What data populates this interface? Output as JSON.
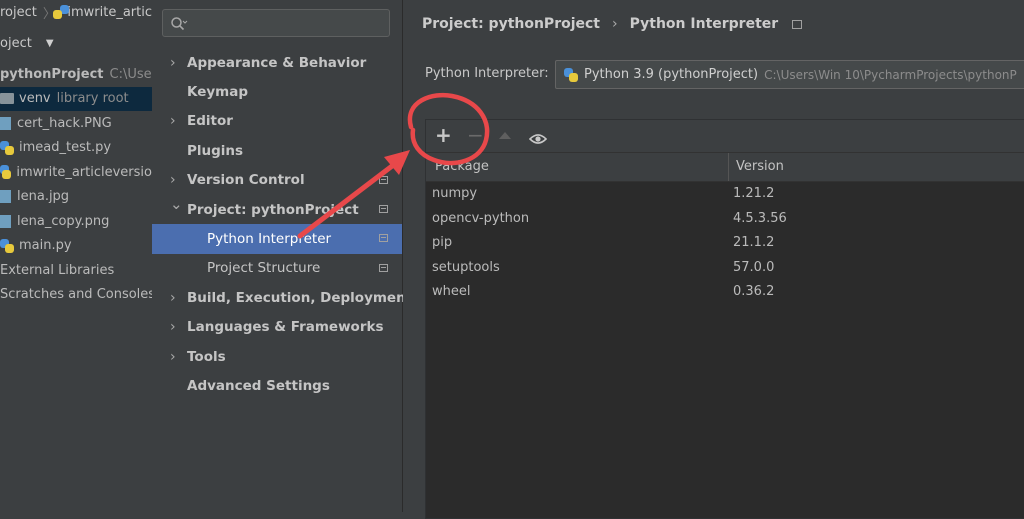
{
  "project_panel": {
    "breadcrumb": {
      "root": "roject",
      "file": "imwrite_artic"
    },
    "header_label": "oject",
    "tree": [
      {
        "label": "pythonProject",
        "hint": "C:\\User",
        "kind": "project"
      },
      {
        "label": "venv",
        "hint": "library root",
        "kind": "folder",
        "selected": true
      },
      {
        "label": "cert_hack.PNG",
        "kind": "image"
      },
      {
        "label": "imead_test.py",
        "kind": "python"
      },
      {
        "label": "imwrite_articleversio",
        "kind": "python"
      },
      {
        "label": "lena.jpg",
        "kind": "image"
      },
      {
        "label": "lena_copy.png",
        "kind": "image"
      },
      {
        "label": "main.py",
        "kind": "python"
      },
      {
        "label": "External Libraries",
        "kind": "libs"
      },
      {
        "label": "Scratches and Consoles",
        "kind": "scratch"
      }
    ]
  },
  "settings_nav": {
    "search_placeholder": "",
    "items": [
      {
        "label": "Appearance & Behavior",
        "expandable": true
      },
      {
        "label": "Keymap",
        "expandable": false
      },
      {
        "label": "Editor",
        "expandable": true
      },
      {
        "label": "Plugins",
        "expandable": false
      },
      {
        "label": "Version Control",
        "expandable": true,
        "project_level": true
      },
      {
        "label": "Project: pythonProject",
        "expandable": true,
        "expanded": true,
        "project_level": true
      },
      {
        "label": "Python Interpreter",
        "sub": true,
        "active": true,
        "project_level": true
      },
      {
        "label": "Project Structure",
        "sub": true,
        "project_level": true
      },
      {
        "label": "Build, Execution, Deployment",
        "expandable": true
      },
      {
        "label": "Languages & Frameworks",
        "expandable": true
      },
      {
        "label": "Tools",
        "expandable": true
      },
      {
        "label": "Advanced Settings",
        "expandable": false
      }
    ]
  },
  "content": {
    "breadcrumb": {
      "parent": "Project: pythonProject",
      "current": "Python Interpreter"
    },
    "interpreter_label": "Python Interpreter:",
    "interpreter_name": "Python 3.9 (pythonProject)",
    "interpreter_path": "C:\\Users\\Win 10\\PycharmProjects\\pythonP",
    "table": {
      "columns": [
        "Package",
        "Version"
      ],
      "rows": [
        {
          "package": "numpy",
          "version": "1.21.2"
        },
        {
          "package": "opencv-python",
          "version": "4.5.3.56"
        },
        {
          "package": "pip",
          "version": "21.1.2"
        },
        {
          "package": "setuptools",
          "version": "57.0.0"
        },
        {
          "package": "wheel",
          "version": "0.36.2"
        }
      ]
    }
  },
  "colors": {
    "annotation_red": "#e8484a",
    "active_item_bg": "#4b6eaf",
    "selected_tree_row_bg": "#0d293e"
  },
  "icons": [
    "search-icon",
    "plus-icon",
    "minus-icon",
    "up-arrow-icon",
    "eye-icon",
    "python-icon",
    "folder-icon",
    "chevron-right-icon",
    "chevron-down-icon"
  ]
}
